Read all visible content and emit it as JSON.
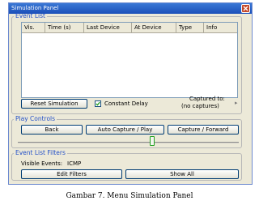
{
  "window": {
    "title": "Simulation Panel"
  },
  "event_list": {
    "legend": "Event List",
    "columns": [
      "Vis.",
      "Time (s)",
      "Last Device",
      "At Device",
      "Type",
      "Info"
    ],
    "rows": []
  },
  "controls": {
    "reset_label": "Reset Simulation",
    "constant_delay_label": "Constant Delay",
    "constant_delay_checked": true,
    "captured_to_label": "Captured to:",
    "captured_to_value": "(no captures)"
  },
  "play_controls": {
    "legend": "Play Controls",
    "back_label": "Back",
    "auto_capture_label": "Auto Capture / Play",
    "capture_forward_label": "Capture / Forward"
  },
  "filters": {
    "legend": "Event List Filters",
    "visible_events_label": "Visible Events:",
    "visible_events_value": "ICMP",
    "edit_filters_label": "Edit Filters",
    "show_all_label": "Show All"
  },
  "caption": "Gambar 7. Menu Simulation Panel",
  "colors": {
    "titlebar": "#1b4fb8",
    "panel_bg": "#ece9d8",
    "legend_text": "#2350c8",
    "slider_thumb_border": "#21a121",
    "close_button": "#c4482a"
  }
}
